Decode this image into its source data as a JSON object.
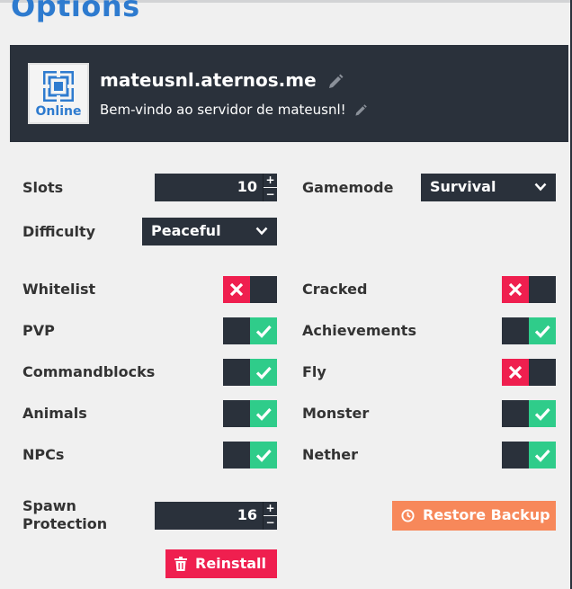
{
  "page": {
    "title": "Options"
  },
  "server": {
    "status": "Online",
    "address": "mateusnl.aternos.me",
    "motd": "Bem-vindo ao servidor de mateusnl!"
  },
  "settings": {
    "slots": {
      "label": "Slots",
      "value": "10"
    },
    "gamemode": {
      "label": "Gamemode",
      "value": "Survival"
    },
    "difficulty": {
      "label": "Difficulty",
      "value": "Peaceful"
    },
    "spawn_protection": {
      "label_line1": "Spawn",
      "label_line2": "Protection",
      "value": "16"
    }
  },
  "toggles": [
    {
      "label": "Whitelist",
      "enabled": false
    },
    {
      "label": "Cracked",
      "enabled": false
    },
    {
      "label": "PVP",
      "enabled": true
    },
    {
      "label": "Achievements",
      "enabled": true
    },
    {
      "label": "Commandblocks",
      "enabled": true
    },
    {
      "label": "Fly",
      "enabled": false
    },
    {
      "label": "Animals",
      "enabled": true
    },
    {
      "label": "Monster",
      "enabled": true
    },
    {
      "label": "NPCs",
      "enabled": true
    },
    {
      "label": "Nether",
      "enabled": true
    }
  ],
  "actions": {
    "restore_backup": "Restore Backup",
    "reinstall": "Reinstall"
  },
  "stepper_symbols": {
    "plus": "+",
    "minus": "−"
  },
  "colors": {
    "title": "#2e7bcf",
    "panel": "#2a313b",
    "toggle_on": "#2fcc8a",
    "toggle_off": "#ef1f4f",
    "restore_button": "#f7885a",
    "reinstall_button": "#ef1f4f"
  },
  "icons": {
    "server_logo": "aternos-logo-icon",
    "edit": "pencil-icon",
    "dropdown": "chevron-down-icon",
    "toggle_on": "check-icon",
    "toggle_off": "x-icon",
    "restore": "clock-icon",
    "reinstall": "trash-icon"
  }
}
